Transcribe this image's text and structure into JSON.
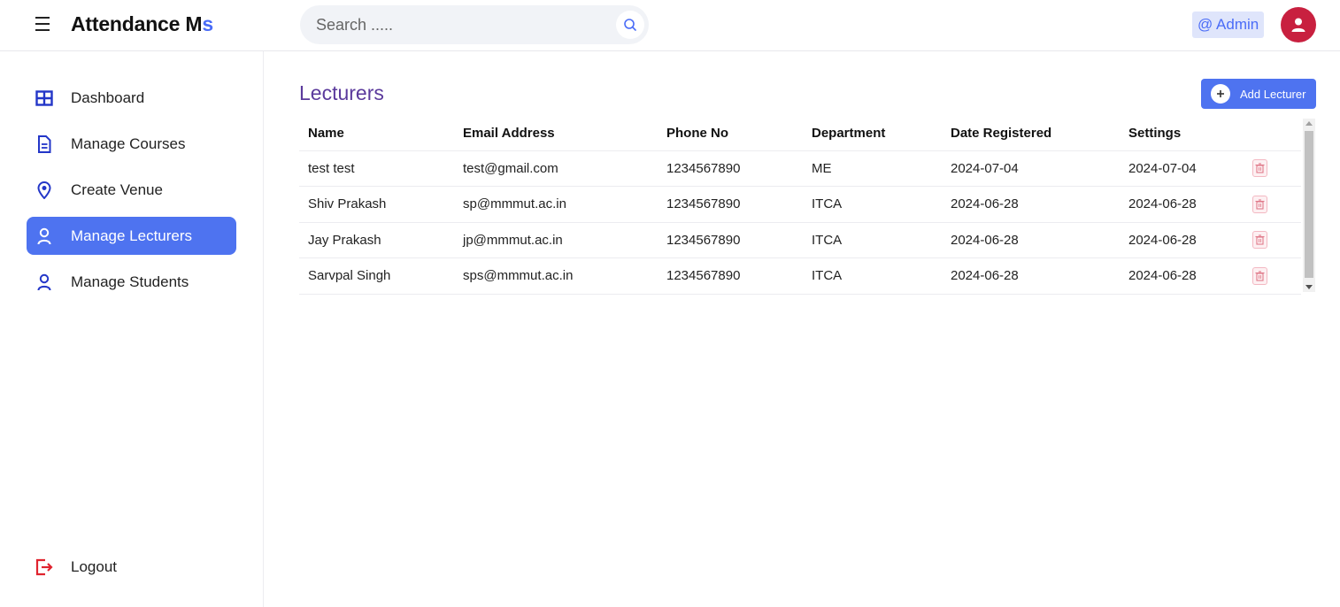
{
  "header": {
    "brand_main": "Attendance M",
    "brand_accent": "s",
    "search_placeholder": "Search .....",
    "search_value": "",
    "admin_label": "@ Admin"
  },
  "sidebar": {
    "items": [
      {
        "label": "Dashboard",
        "icon": "grid-icon",
        "active": false
      },
      {
        "label": "Manage Courses",
        "icon": "document-icon",
        "active": false
      },
      {
        "label": "Create Venue",
        "icon": "location-pin-icon",
        "active": false
      },
      {
        "label": "Manage Lecturers",
        "icon": "user-icon",
        "active": true
      },
      {
        "label": "Manage Students",
        "icon": "user-icon",
        "active": false
      }
    ],
    "logout_label": "Logout"
  },
  "main": {
    "title": "Lecturers",
    "add_button_label": "Add Lecturer",
    "table": {
      "headers": [
        "Name",
        "Email Address",
        "Phone No",
        "Department",
        "Date Registered",
        "Settings"
      ],
      "rows": [
        [
          "test test",
          "test@gmail.com",
          "1234567890",
          "ME",
          "2024-07-04",
          "2024-07-04"
        ],
        [
          "Shiv Prakash",
          "sp@mmmut.ac.in",
          "1234567890",
          "ITCA",
          "2024-06-28",
          "2024-06-28"
        ],
        [
          "Jay Prakash",
          "jp@mmmut.ac.in",
          "1234567890",
          "ITCA",
          "2024-06-28",
          "2024-06-28"
        ],
        [
          "Sarvpal Singh",
          "sps@mmmut.ac.in",
          "1234567890",
          "ITCA",
          "2024-06-28",
          "2024-06-28"
        ]
      ]
    }
  },
  "colors": {
    "accent": "#4e73f0",
    "title": "#5b3a9c",
    "avatar": "#c8203f",
    "logout": "#e0242f",
    "delete": "#e07a8a"
  }
}
